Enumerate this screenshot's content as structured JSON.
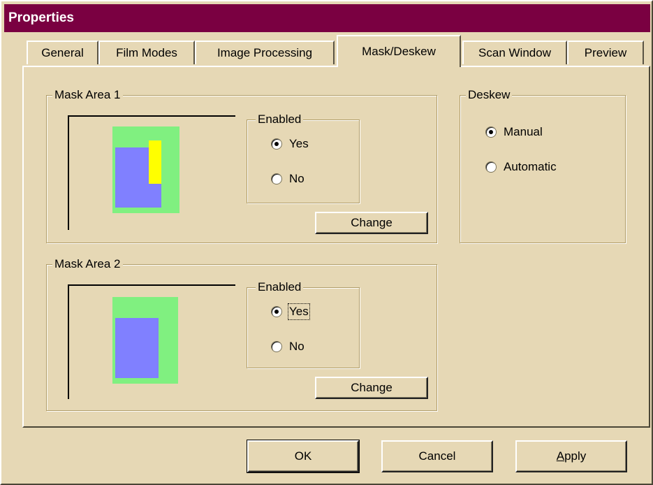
{
  "window": {
    "title": "Properties"
  },
  "tabs": [
    {
      "label": "General"
    },
    {
      "label": "Film Modes"
    },
    {
      "label": "Image Processing"
    },
    {
      "label": "Mask/Deskew",
      "active": true
    },
    {
      "label": "Scan Window"
    },
    {
      "label": "Preview"
    }
  ],
  "mask_area_1": {
    "legend": "Mask Area 1",
    "enabled_legend": "Enabled",
    "yes_label": "Yes",
    "no_label": "No",
    "selected": "Yes",
    "change_label": "Change"
  },
  "mask_area_2": {
    "legend": "Mask Area 2",
    "enabled_legend": "Enabled",
    "yes_label": "Yes",
    "no_label": "No",
    "selected": "Yes",
    "change_label": "Change"
  },
  "deskew": {
    "legend": "Deskew",
    "manual_label": "Manual",
    "automatic_label": "Automatic",
    "selected": "Manual"
  },
  "footer": {
    "ok_label": "OK",
    "cancel_label": "Cancel",
    "apply_accel": "A",
    "apply_rest": "pply"
  },
  "colors": {
    "titlebar": "#7A0041",
    "dialog_bg": "#E6D8B5",
    "preview_green": "#80F080",
    "preview_blue": "#8080FF",
    "preview_yellow": "#FFFF00"
  }
}
